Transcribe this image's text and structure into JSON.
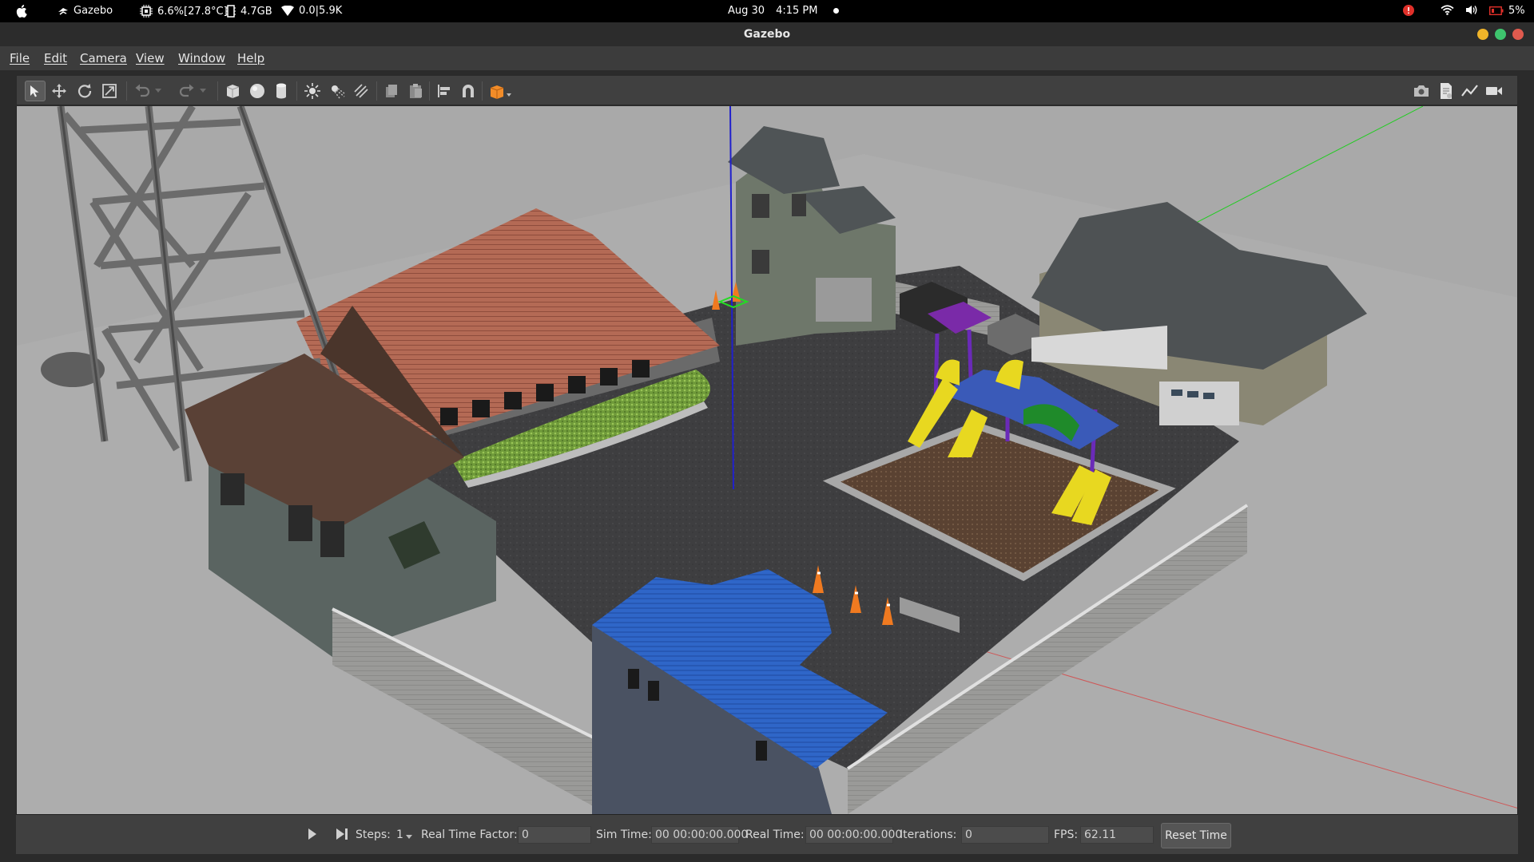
{
  "system_bar": {
    "app_name": "Gazebo",
    "cpu": "6.6%[27.8°C]",
    "memory": "4.7GB",
    "network": "0.0|5.9K",
    "date": "Aug 30",
    "time": "4:15 PM",
    "battery": "5%"
  },
  "window": {
    "title": "Gazebo"
  },
  "menu": {
    "items": [
      "File",
      "Edit",
      "Camera",
      "View",
      "Window",
      "Help"
    ]
  },
  "toolbar": {
    "tools": [
      "select-mode",
      "translate-mode",
      "rotate-mode",
      "scale-mode",
      "undo",
      "undo-history",
      "redo",
      "redo-history",
      "box-shape",
      "sphere-shape",
      "cylinder-shape",
      "point-light",
      "spot-light",
      "directional-light",
      "copy",
      "paste",
      "align",
      "snap",
      "change-view-angle",
      "screenshot",
      "log-data",
      "plot",
      "record-video"
    ],
    "active_tool": "select-mode"
  },
  "status": {
    "steps_label": "Steps:",
    "steps_value": "1",
    "rtf_label": "Real Time Factor:",
    "rtf_value": "0",
    "sim_time_label": "Sim Time:",
    "sim_time_value": "00 00:00:00.000",
    "real_time_label": "Real Time:",
    "real_time_value": "00 00:00:00.000",
    "iterations_label": "Iterations:",
    "iterations_value": "0",
    "fps_label": "FPS:",
    "fps_value": "62.11",
    "reset_label": "Reset Time"
  },
  "colors": {
    "window_bg": "#3c3c3c",
    "viewport_bg": "#a8a8a8",
    "close": "#e05a4e",
    "minimize": "#f0b429",
    "maximize": "#3ec46d",
    "selection_icon": "#f28c28"
  }
}
